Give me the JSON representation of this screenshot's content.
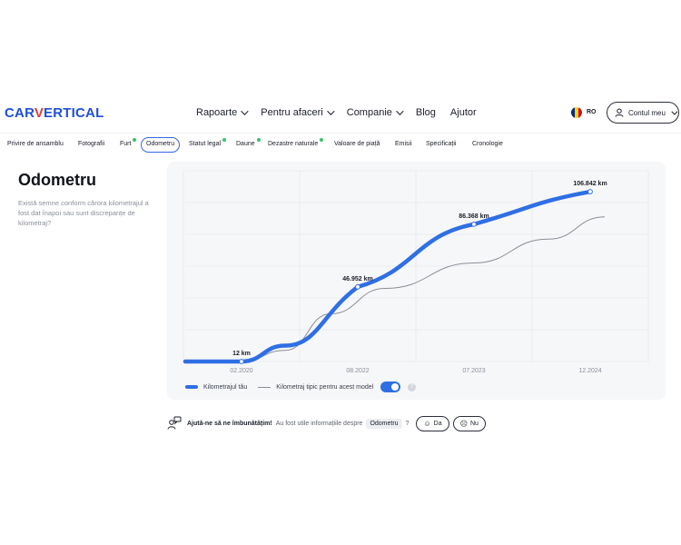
{
  "brand": {
    "logo_pre": "CAR",
    "logo_v": "V",
    "logo_post": "ERTICAL"
  },
  "nav": [
    {
      "label": "Rapoarte",
      "has_dropdown": true
    },
    {
      "label": "Pentru afaceri",
      "has_dropdown": true
    },
    {
      "label": "Companie",
      "has_dropdown": true
    },
    {
      "label": "Blog",
      "has_dropdown": false
    },
    {
      "label": "Ajutor",
      "has_dropdown": false
    }
  ],
  "language": {
    "code": "RO",
    "flag_colors": [
      "#002B7F",
      "#FCD116",
      "#CE1126"
    ]
  },
  "account": {
    "label": "Contul meu"
  },
  "tabs": [
    {
      "label": "Privire de ansamblu",
      "dot": false,
      "active": false
    },
    {
      "label": "Fotografii",
      "dot": false,
      "active": false
    },
    {
      "label": "Furt",
      "dot": true,
      "active": false
    },
    {
      "label": "Odometru",
      "dot": false,
      "active": true
    },
    {
      "label": "Statut legal",
      "dot": true,
      "active": false
    },
    {
      "label": "Daune",
      "dot": true,
      "active": false
    },
    {
      "label": "Dezastre naturale",
      "dot": true,
      "active": false
    },
    {
      "label": "Valoare de piață",
      "dot": false,
      "active": false
    },
    {
      "label": "Emisii",
      "dot": false,
      "active": false
    },
    {
      "label": "Specificații",
      "dot": false,
      "active": false
    },
    {
      "label": "Cronologie",
      "dot": false,
      "active": false
    }
  ],
  "section": {
    "title": "Odometru",
    "description": "Există semne conform cărora kilometrajul a fost dat înapoi sau sunt discrepanțe de kilometraj?"
  },
  "chart_data": {
    "type": "line",
    "x": [
      "02.2020",
      "08.2022",
      "07.2023",
      "12.2024"
    ],
    "series": [
      {
        "name": "Kilometrajul tău",
        "values": [
          12,
          46952,
          86368,
          106842
        ],
        "value_labels": [
          "12 km",
          "46.952 km",
          "86.368 km",
          "106.842 km"
        ],
        "color": "#2f6fe4"
      },
      {
        "name": "Kilometraj tipic pentru acest model",
        "color": "#8a8d94"
      }
    ],
    "grid": true,
    "legend": "bottom-left"
  },
  "legend": {
    "series1": "Kilometrajul tău",
    "series2": "Kilometraj tipic pentru acest model",
    "toggle_on": true,
    "help": "?"
  },
  "feedback": {
    "question": "Ajută-ne să ne îmbunătățim!",
    "text": "Au fost utile informațiile despre",
    "topic": "Odometru",
    "qmark": "?",
    "yes": "Da",
    "no": "Nu"
  }
}
